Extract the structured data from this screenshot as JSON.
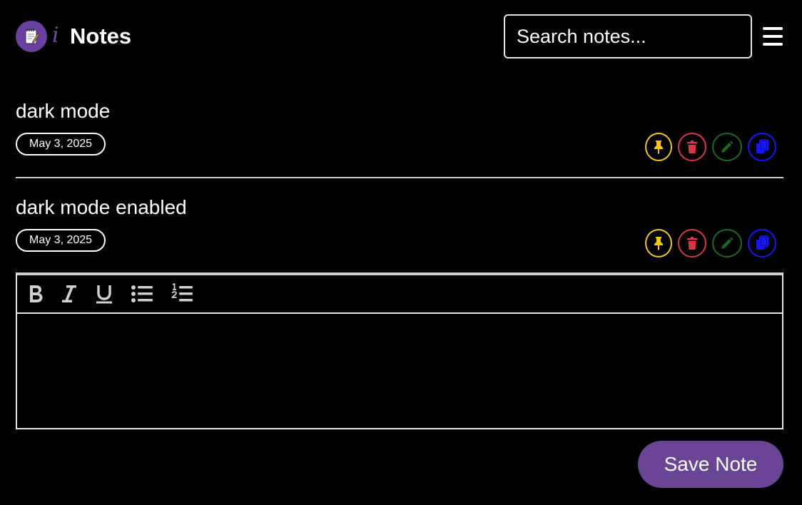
{
  "header": {
    "info_glyph": "i",
    "title": "Notes",
    "logo_icon": "notepad-icon",
    "search_placeholder": "Search notes...",
    "menu_icon": "hamburger-menu-icon"
  },
  "notes": [
    {
      "title": "dark mode",
      "date": "May 3, 2025"
    },
    {
      "title": "dark mode enabled",
      "date": "May 3, 2025"
    }
  ],
  "note_action_icons": [
    "pin-icon",
    "trash-icon",
    "pencil-icon",
    "copy-icon"
  ],
  "editor": {
    "toolbar_icons": [
      "bold-icon",
      "italic-icon",
      "underline-icon",
      "bullet-list-icon",
      "numbered-list-icon"
    ],
    "content": ""
  },
  "save_label": "Save Note",
  "colors": {
    "background": "#000000",
    "accent": "#6a4596",
    "pin": "#f5c518",
    "delete": "#dc3545",
    "edit": "#1a6b1a",
    "copy": "#1414ff"
  }
}
